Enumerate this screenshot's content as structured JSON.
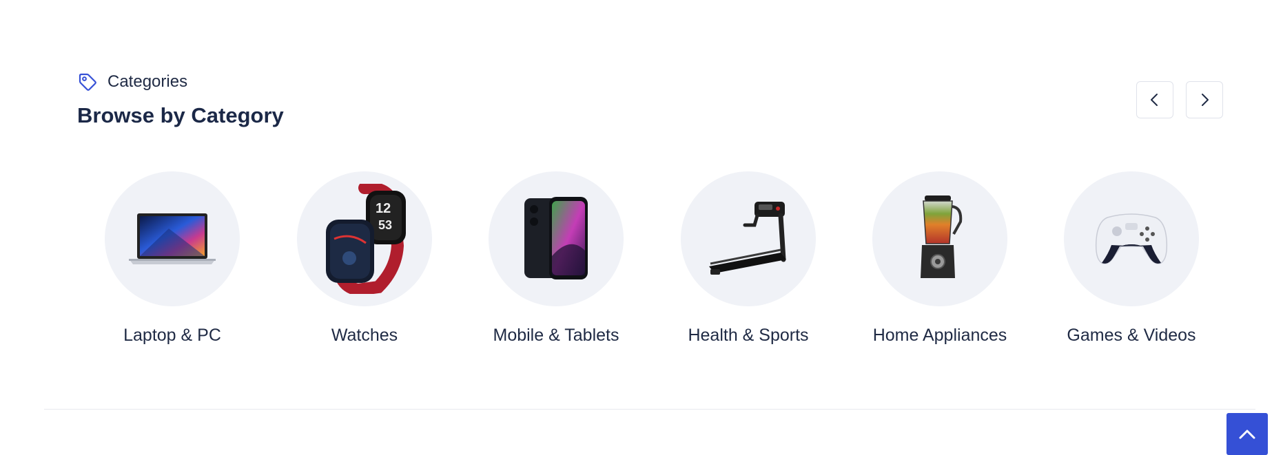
{
  "header": {
    "eyebrow": "Categories",
    "title": "Browse by Category",
    "eyebrow_icon": "tag-icon",
    "accent_color": "#3550d6",
    "prev_icon": "chevron-left-icon",
    "next_icon": "chevron-right-icon"
  },
  "categories": [
    {
      "label": "Laptop & PC",
      "icon": "laptop-icon"
    },
    {
      "label": "Watches",
      "icon": "smartwatch-icon"
    },
    {
      "label": "Mobile & Tablets",
      "icon": "smartphone-icon"
    },
    {
      "label": "Health & Sports",
      "icon": "treadmill-icon"
    },
    {
      "label": "Home Appliances",
      "icon": "blender-icon"
    },
    {
      "label": "Games & Videos",
      "icon": "gamepad-icon"
    }
  ],
  "scroll_top": {
    "icon": "chevron-up-icon",
    "color": "#3550d6"
  }
}
